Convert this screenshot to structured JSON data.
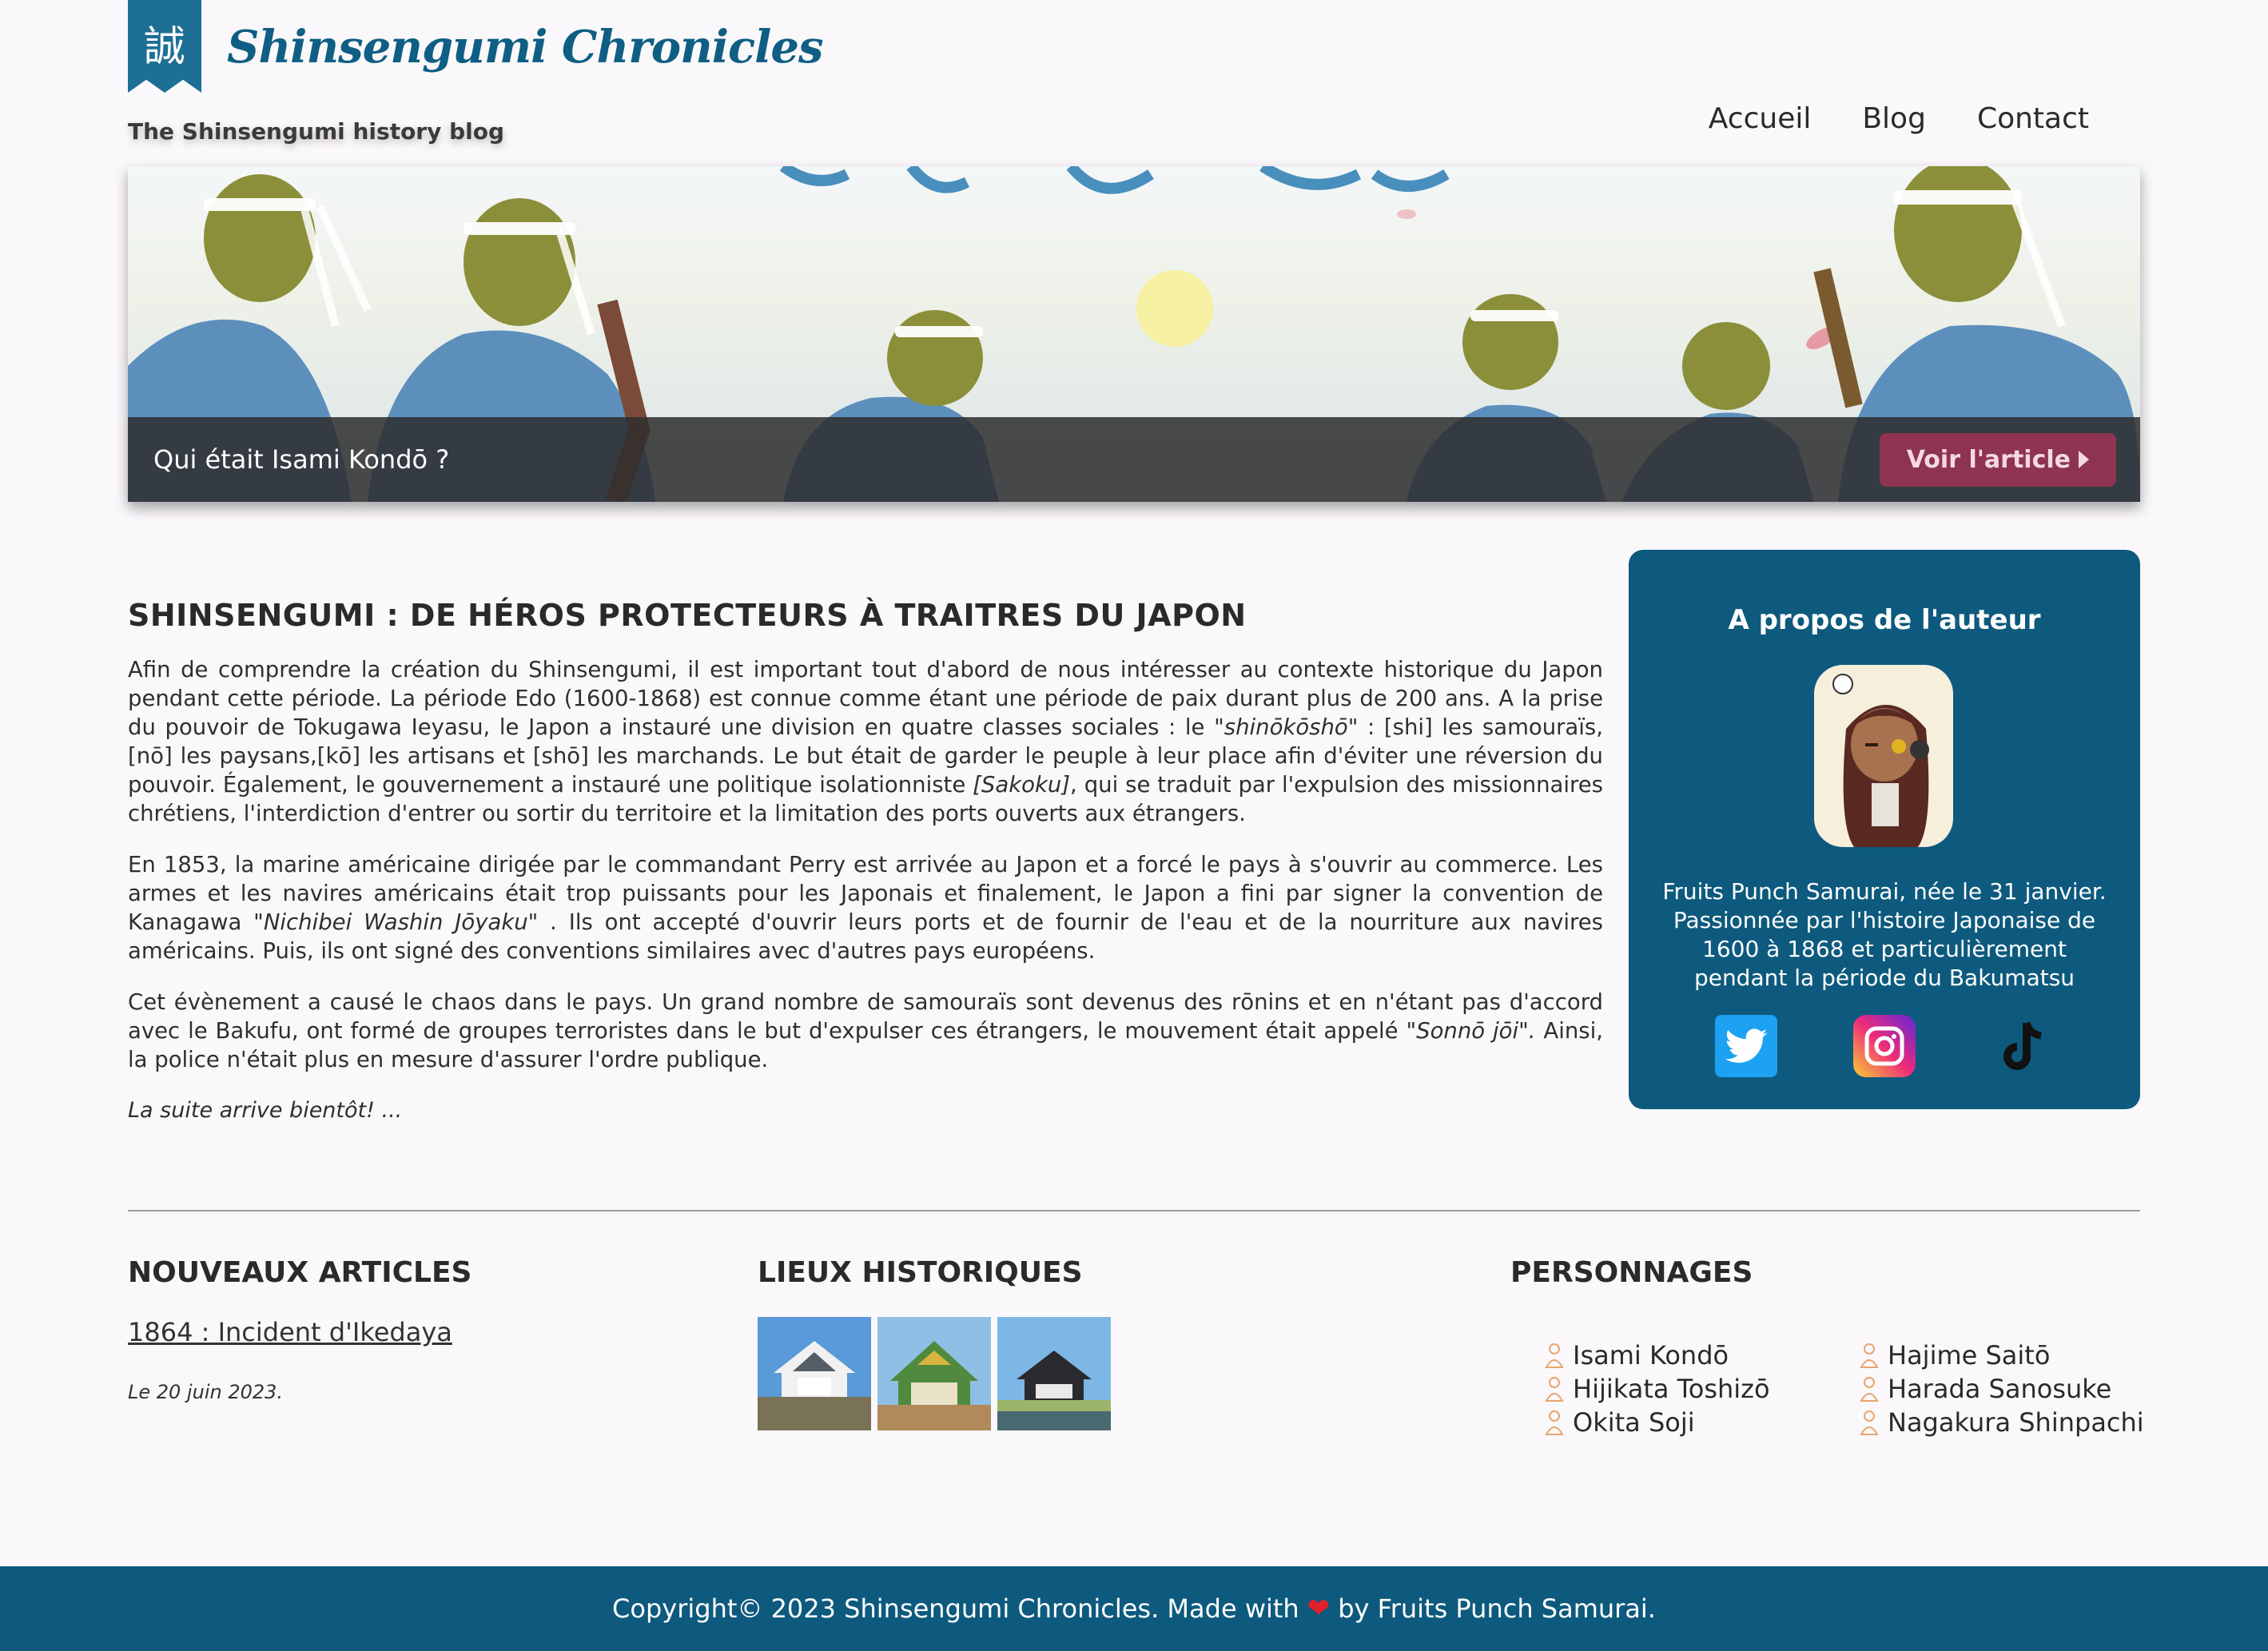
{
  "header": {
    "logo_kanji": "誠",
    "site_title": "Shinsengumi Chronicles",
    "tagline": "The Shinsengumi history blog",
    "nav": [
      "Accueil",
      "Blog",
      "Contact"
    ]
  },
  "hero": {
    "caption": "Qui était Isami Kondō ?",
    "button": "Voir l'article"
  },
  "article": {
    "title": "SHINSENGUMI : DE HÉROS PROTECTEURS À TRAITRES DU JAPON",
    "p1_a": "Afin de comprendre la création du Shinsengumi, il est important tout d'abord de nous intéresser au contexte historique du Japon pendant cette période. La période Edo (1600-1868) est connue comme étant une période de paix durant plus de 200 ans. A la prise du pouvoir de Tokugawa Ieyasu, le Japon a instauré une division en quatre classes sociales : le ",
    "p1_em1": "\"shinōkōshō\"",
    "p1_b": " : [shi] les samouraïs, [nō] les paysans,[kō] les artisans et [shō] les marchands. Le but était de garder le peuple à leur place afin d'éviter une réversion du pouvoir. Également, le gouvernement a instauré une politique isolationniste ",
    "p1_em2": "[Sakoku]",
    "p1_c": ", qui se traduit par l'expulsion des missionnaires chrétiens, l'interdiction d'entrer ou sortir du territoire et la limitation des ports ouverts aux étrangers.",
    "p2_a": "En 1853, la marine américaine dirigée par le commandant Perry est arrivée au Japon et a forcé le pays à s'ouvrir au commerce. Les armes et les navires américains était trop puissants pour les Japonais et finalement, le Japon a fini par signer la convention de Kanagawa ",
    "p2_em": "\"Nichibei Washin Jōyaku\"",
    "p2_b": " . Ils ont accepté d'ouvrir leurs ports et de fournir de l'eau et de la nourriture aux navires américains. Puis, ils ont signé des conventions similaires avec d'autres pays européens.",
    "p3_a": "Cet évènement a causé le chaos dans le pays. Un grand nombre de samouraïs sont devenus des rōnins et en n'étant pas d'accord avec le Bakufu, ont formé de groupes terroristes dans le but d'expulser ces étrangers, le mouvement était appelé ",
    "p3_em": "\"Sonnō jōi\".",
    "p3_b": " Ainsi, la police n'était plus en mesure d'assurer l'ordre publique.",
    "teaser": "La suite arrive bientôt! ..."
  },
  "sidebar": {
    "title": "A propos de l'auteur",
    "bio": "Fruits Punch Samurai, née le 31 janvier. Passionnée par l'histoire Japonaise de 1600 à 1868 et particulièrement pendant la période du Bakumatsu",
    "socials": [
      "twitter-icon",
      "instagram-icon",
      "tiktok-icon"
    ]
  },
  "new_articles": {
    "title": "NOUVEAUX ARTICLES",
    "link": "1864 : Incident d'Ikedaya",
    "date": "Le 20 juin 2023."
  },
  "places": {
    "title": "LIEUX HISTORIQUES"
  },
  "characters": {
    "title": "PERSONNAGES",
    "items": [
      "Isami Kondō",
      "Hajime Saitō",
      "Hijikata Toshizō",
      "Harada Sanosuke",
      "Okita Soji",
      "Nagakura Shinpachi"
    ]
  },
  "footer": {
    "before": "Copyright© 2023 Shinsengumi Chronicles. Made with",
    "heart": "❤",
    "after": "by Fruits Punch Samurai."
  },
  "colors": {
    "brand": "#0e5a7e",
    "button": "#8e3350",
    "background": "#fbf8fc"
  }
}
